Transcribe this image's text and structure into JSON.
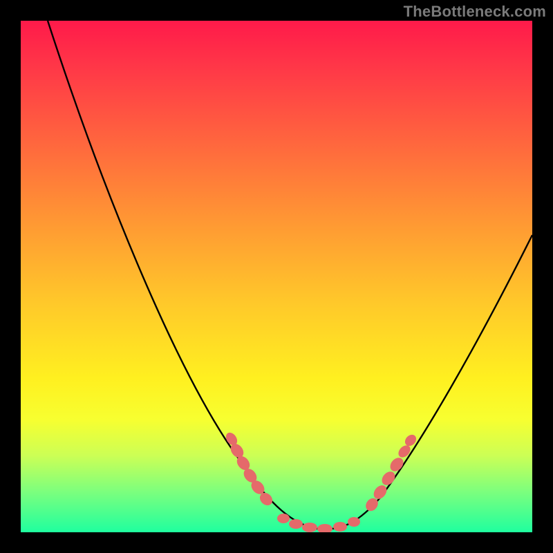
{
  "watermark": "TheBottleneck.com",
  "chart_data": {
    "type": "line",
    "title": "",
    "xlabel": "",
    "ylabel": "",
    "xlim": [
      0,
      100
    ],
    "ylim": [
      0,
      100
    ],
    "series": [
      {
        "name": "bottleneck-curve",
        "x": [
          5,
          10,
          15,
          20,
          25,
          30,
          35,
          40,
          45,
          50,
          52,
          55,
          58,
          60,
          63,
          65,
          70,
          75,
          80,
          85,
          90,
          95,
          100
        ],
        "values": [
          100,
          88,
          76,
          64,
          52,
          41,
          30,
          21,
          13,
          6,
          3,
          1,
          0,
          0,
          1,
          3,
          9,
          17,
          26,
          35,
          44,
          52,
          58
        ]
      }
    ],
    "annotations": [
      {
        "name": "marker-cluster-left",
        "x_range": [
          39,
          45
        ],
        "y_range": [
          13,
          24
        ]
      },
      {
        "name": "marker-cluster-bottom",
        "x_range": [
          50,
          65
        ],
        "y_range": [
          0,
          4
        ]
      },
      {
        "name": "marker-cluster-right",
        "x_range": [
          68,
          75
        ],
        "y_range": [
          9,
          20
        ]
      }
    ],
    "colors": {
      "curve": "#000000",
      "markers": "#e56a6a",
      "gradient_top": "#ff1a4a",
      "gradient_bottom": "#1fff9f",
      "background": "#000000",
      "watermark": "#7a7a7a"
    }
  }
}
